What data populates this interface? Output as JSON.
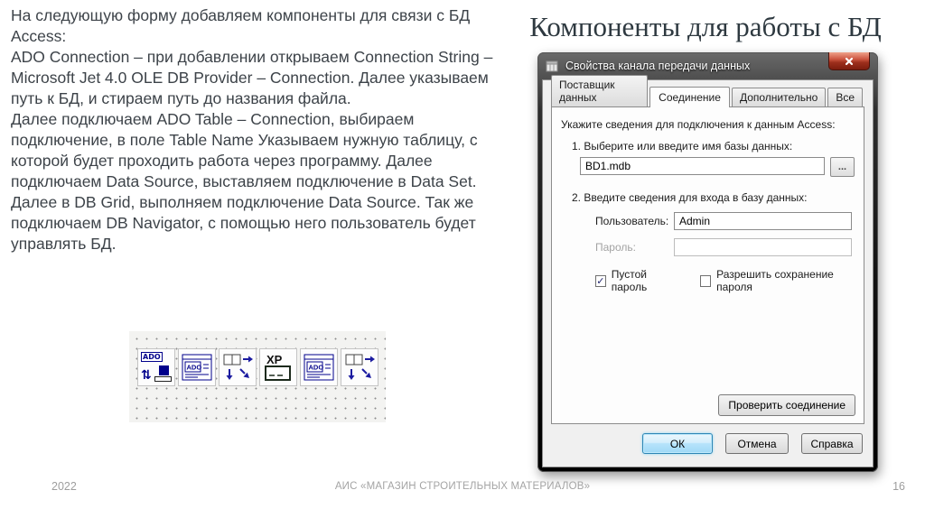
{
  "slide": {
    "paragraphs": [
      "На следующую форму добавляем компоненты для связи с БД Access:",
      "ADO Connection – при добавлении открываем Connection String – Microsoft Jet 4.0 OLE DB Provider – Connection. Далее указываем путь к БД, и стираем путь до названия файла.",
      "Далее подключаем ADO Table – Connection, выбираем подключение, в поле Table Name Указываем нужную таблицу, с которой будет проходить работа через программу. Далее подключаем Data Source, выставляем подключение в Data Set. Далее в DB Grid, выполняем подключение Data Source. Так же подключаем DB Navigator, с помощью него пользователь будет управлять БД."
    ],
    "title": "Компоненты для работы с БД",
    "footer": {
      "year": "2022",
      "center": "АИС «МАГАЗИН СТРОИТЕЛЬНЫХ МАТЕРИАЛОВ»",
      "page": "16"
    }
  },
  "toolbar": {
    "icons": [
      {
        "name": "ado-connection-icon",
        "label": "ADO"
      },
      {
        "name": "ado-table-icon",
        "label": "ADO"
      },
      {
        "name": "data-source-icon",
        "label": ""
      },
      {
        "name": "xp-manifest-icon",
        "label": "XP"
      },
      {
        "name": "ado-table-icon",
        "label": "ADO"
      },
      {
        "name": "data-source-icon",
        "label": ""
      }
    ]
  },
  "dialog": {
    "title": "Свойства канала передачи данных",
    "tabs": [
      {
        "label": "Поставщик данных"
      },
      {
        "label": "Соединение"
      },
      {
        "label": "Дополнительно"
      },
      {
        "label": "Все"
      }
    ],
    "heading": "Укажите сведения для подключения к данным Access:",
    "step1": "1. Выберите или введите имя базы данных:",
    "db_value": "BD1.mdb",
    "browse_label": "...",
    "step2": "2. Введите сведения для входа в базу данных:",
    "user_label": "Пользователь:",
    "user_value": "Admin",
    "password_label": "Пароль:",
    "checkbox_blank_password": "Пустой пароль",
    "checkbox_save_password": "Разрешить сохранение пароля",
    "check_glyph": "✓",
    "test_button": "Проверить соединение",
    "ok": "ОК",
    "cancel": "Отмена",
    "help": "Справка"
  }
}
